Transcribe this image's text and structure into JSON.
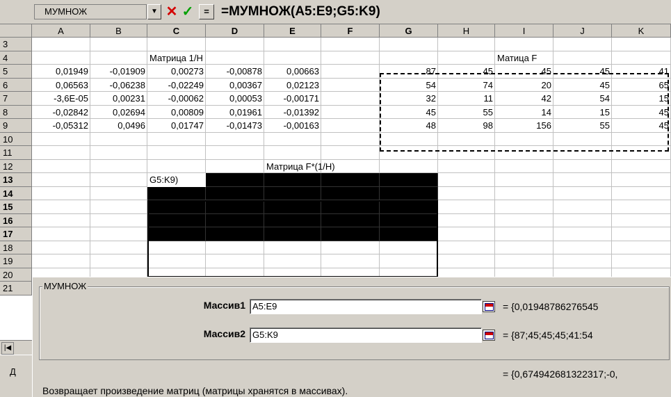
{
  "formula_bar": {
    "name_box": "МУМНОЖ",
    "cancel_glyph": "✕",
    "enter_glyph": "✓",
    "equals_glyph": "=",
    "formula": "=МУМНОЖ(A5:E9;G5:K9)"
  },
  "columns": [
    "A",
    "B",
    "C",
    "D",
    "E",
    "F",
    "G",
    "H",
    "I",
    "J",
    "K"
  ],
  "rows": [
    "3",
    "4",
    "5",
    "6",
    "7",
    "8",
    "9",
    "10",
    "11",
    "12",
    "13",
    "14",
    "15",
    "16",
    "17",
    "18",
    "19",
    "20",
    "21"
  ],
  "labels": {
    "matrix_inv_h": "Матрица 1/H",
    "matrix_f": "Матица F",
    "matrix_product": "Матрица F*(1/H)"
  },
  "matrix_a": [
    [
      "0,01949",
      "-0,01909",
      "0,00273",
      "-0,00878",
      "0,00663"
    ],
    [
      "0,06563",
      "-0,06238",
      "-0,02249",
      "0,00367",
      "0,02123"
    ],
    [
      "-3,6E-05",
      "0,00231",
      "-0,00062",
      "0,00053",
      "-0,00171"
    ],
    [
      "-0,02842",
      "0,02694",
      "0,00809",
      "0,01961",
      "-0,01392"
    ],
    [
      "-0,05312",
      "0,0496",
      "0,01747",
      "-0,01473",
      "-0,00163"
    ]
  ],
  "matrix_f": [
    [
      "87",
      "45",
      "45",
      "45",
      "41"
    ],
    [
      "54",
      "74",
      "20",
      "45",
      "65"
    ],
    [
      "32",
      "11",
      "42",
      "54",
      "15"
    ],
    [
      "45",
      "55",
      "14",
      "15",
      "45"
    ],
    [
      "48",
      "98",
      "156",
      "55",
      "45"
    ]
  ],
  "edit_cell_text": "G5:K9)",
  "dialog": {
    "group_title": "МУМНОЖ",
    "arg1_label": "Массив1",
    "arg1_value": "A5:E9",
    "arg1_result": "= {0,01948786276545",
    "arg2_label": "Массив2",
    "arg2_value": "G5:K9",
    "arg2_result": "= {87;45;45;45;41:54",
    "result": "= {0,674942681322317;-0,",
    "description": "Возвращает произведение матриц (матрицы хранятся в массивах)."
  },
  "status_fragment": "Д",
  "tab_first_glyph": "|◀"
}
